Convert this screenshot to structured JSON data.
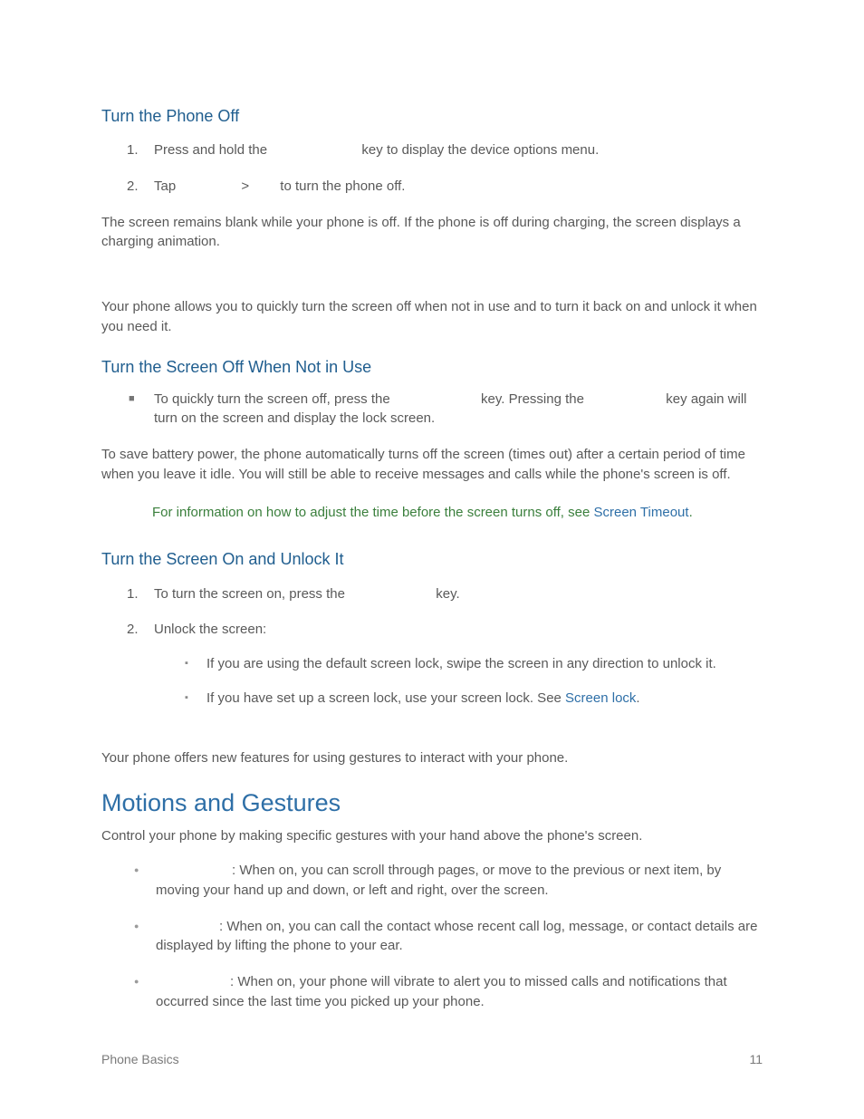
{
  "sections": {
    "turn_phone_off": {
      "heading": "Turn the Phone Off",
      "step1_a": "Press and hold the ",
      "step1_b": " key to display the device options menu.",
      "step2_a": "Tap ",
      "step2_sep": ">",
      "step2_b": " to turn the phone off.",
      "para": "The screen remains blank while your phone is off. If the phone is off during charging, the screen displays a charging animation."
    },
    "intro_screen": "Your phone allows you to quickly turn the screen off when not in use and to turn it back on and unlock it when you need it.",
    "turn_screen_off": {
      "heading": "Turn the Screen Off When Not in Use",
      "bullet_a": "To quickly turn the screen off, press the ",
      "bullet_b": " key. Pressing the ",
      "bullet_c": " key again will turn on the screen and display the lock screen.",
      "para": "To save battery power, the phone automatically turns off the screen (times out) after a certain period of time when you leave it idle. You will still be able to receive messages and calls while the phone's screen is off.",
      "note_a": "For information on how to adjust the time before the screen turns off, see ",
      "note_link": "Screen Timeout",
      "note_b": "."
    },
    "turn_screen_on": {
      "heading": "Turn the Screen On and Unlock It",
      "step1_a": "To turn the screen on, press the ",
      "step1_b": " key.",
      "step2": "Unlock the screen:",
      "sub1": "If you are using the default screen lock, swipe the screen in any direction to unlock it.",
      "sub2_a": "If you have set up a screen lock, use  your screen lock. See ",
      "sub2_link": "Screen lock",
      "sub2_b": "."
    },
    "intro_gestures": "Your phone offers new features for using gestures to interact with your phone.",
    "motions": {
      "heading": "Motions and Gestures",
      "intro": "Control your phone by making specific gestures with your hand above the phone's screen.",
      "item1": ": When on, you can scroll through pages, or move to the previous or next item, by moving your hand up and down, or left and right, over the screen.",
      "item2": ": When on, you can call the contact whose recent call log, message, or contact details are displayed by lifting the phone to your ear.",
      "item3": ": When on, your phone will vibrate to alert you to missed calls and notifications that occurred since the last time you picked up your phone."
    }
  },
  "list_numbers": {
    "n1": "1.",
    "n2": "2."
  },
  "footer": {
    "section": "Phone Basics",
    "page": "11"
  }
}
